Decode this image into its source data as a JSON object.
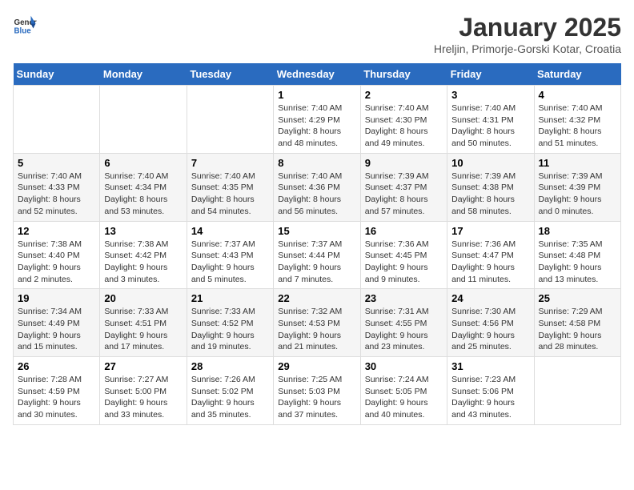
{
  "header": {
    "logo_general": "General",
    "logo_blue": "Blue",
    "title": "January 2025",
    "subtitle": "Hreljin, Primorje-Gorski Kotar, Croatia"
  },
  "days_of_week": [
    "Sunday",
    "Monday",
    "Tuesday",
    "Wednesday",
    "Thursday",
    "Friday",
    "Saturday"
  ],
  "weeks": [
    [
      {
        "day": "",
        "info": ""
      },
      {
        "day": "",
        "info": ""
      },
      {
        "day": "",
        "info": ""
      },
      {
        "day": "1",
        "info": "Sunrise: 7:40 AM\nSunset: 4:29 PM\nDaylight: 8 hours and 48 minutes."
      },
      {
        "day": "2",
        "info": "Sunrise: 7:40 AM\nSunset: 4:30 PM\nDaylight: 8 hours and 49 minutes."
      },
      {
        "day": "3",
        "info": "Sunrise: 7:40 AM\nSunset: 4:31 PM\nDaylight: 8 hours and 50 minutes."
      },
      {
        "day": "4",
        "info": "Sunrise: 7:40 AM\nSunset: 4:32 PM\nDaylight: 8 hours and 51 minutes."
      }
    ],
    [
      {
        "day": "5",
        "info": "Sunrise: 7:40 AM\nSunset: 4:33 PM\nDaylight: 8 hours and 52 minutes."
      },
      {
        "day": "6",
        "info": "Sunrise: 7:40 AM\nSunset: 4:34 PM\nDaylight: 8 hours and 53 minutes."
      },
      {
        "day": "7",
        "info": "Sunrise: 7:40 AM\nSunset: 4:35 PM\nDaylight: 8 hours and 54 minutes."
      },
      {
        "day": "8",
        "info": "Sunrise: 7:40 AM\nSunset: 4:36 PM\nDaylight: 8 hours and 56 minutes."
      },
      {
        "day": "9",
        "info": "Sunrise: 7:39 AM\nSunset: 4:37 PM\nDaylight: 8 hours and 57 minutes."
      },
      {
        "day": "10",
        "info": "Sunrise: 7:39 AM\nSunset: 4:38 PM\nDaylight: 8 hours and 58 minutes."
      },
      {
        "day": "11",
        "info": "Sunrise: 7:39 AM\nSunset: 4:39 PM\nDaylight: 9 hours and 0 minutes."
      }
    ],
    [
      {
        "day": "12",
        "info": "Sunrise: 7:38 AM\nSunset: 4:40 PM\nDaylight: 9 hours and 2 minutes."
      },
      {
        "day": "13",
        "info": "Sunrise: 7:38 AM\nSunset: 4:42 PM\nDaylight: 9 hours and 3 minutes."
      },
      {
        "day": "14",
        "info": "Sunrise: 7:37 AM\nSunset: 4:43 PM\nDaylight: 9 hours and 5 minutes."
      },
      {
        "day": "15",
        "info": "Sunrise: 7:37 AM\nSunset: 4:44 PM\nDaylight: 9 hours and 7 minutes."
      },
      {
        "day": "16",
        "info": "Sunrise: 7:36 AM\nSunset: 4:45 PM\nDaylight: 9 hours and 9 minutes."
      },
      {
        "day": "17",
        "info": "Sunrise: 7:36 AM\nSunset: 4:47 PM\nDaylight: 9 hours and 11 minutes."
      },
      {
        "day": "18",
        "info": "Sunrise: 7:35 AM\nSunset: 4:48 PM\nDaylight: 9 hours and 13 minutes."
      }
    ],
    [
      {
        "day": "19",
        "info": "Sunrise: 7:34 AM\nSunset: 4:49 PM\nDaylight: 9 hours and 15 minutes."
      },
      {
        "day": "20",
        "info": "Sunrise: 7:33 AM\nSunset: 4:51 PM\nDaylight: 9 hours and 17 minutes."
      },
      {
        "day": "21",
        "info": "Sunrise: 7:33 AM\nSunset: 4:52 PM\nDaylight: 9 hours and 19 minutes."
      },
      {
        "day": "22",
        "info": "Sunrise: 7:32 AM\nSunset: 4:53 PM\nDaylight: 9 hours and 21 minutes."
      },
      {
        "day": "23",
        "info": "Sunrise: 7:31 AM\nSunset: 4:55 PM\nDaylight: 9 hours and 23 minutes."
      },
      {
        "day": "24",
        "info": "Sunrise: 7:30 AM\nSunset: 4:56 PM\nDaylight: 9 hours and 25 minutes."
      },
      {
        "day": "25",
        "info": "Sunrise: 7:29 AM\nSunset: 4:58 PM\nDaylight: 9 hours and 28 minutes."
      }
    ],
    [
      {
        "day": "26",
        "info": "Sunrise: 7:28 AM\nSunset: 4:59 PM\nDaylight: 9 hours and 30 minutes."
      },
      {
        "day": "27",
        "info": "Sunrise: 7:27 AM\nSunset: 5:00 PM\nDaylight: 9 hours and 33 minutes."
      },
      {
        "day": "28",
        "info": "Sunrise: 7:26 AM\nSunset: 5:02 PM\nDaylight: 9 hours and 35 minutes."
      },
      {
        "day": "29",
        "info": "Sunrise: 7:25 AM\nSunset: 5:03 PM\nDaylight: 9 hours and 37 minutes."
      },
      {
        "day": "30",
        "info": "Sunrise: 7:24 AM\nSunset: 5:05 PM\nDaylight: 9 hours and 40 minutes."
      },
      {
        "day": "31",
        "info": "Sunrise: 7:23 AM\nSunset: 5:06 PM\nDaylight: 9 hours and 43 minutes."
      },
      {
        "day": "",
        "info": ""
      }
    ]
  ]
}
